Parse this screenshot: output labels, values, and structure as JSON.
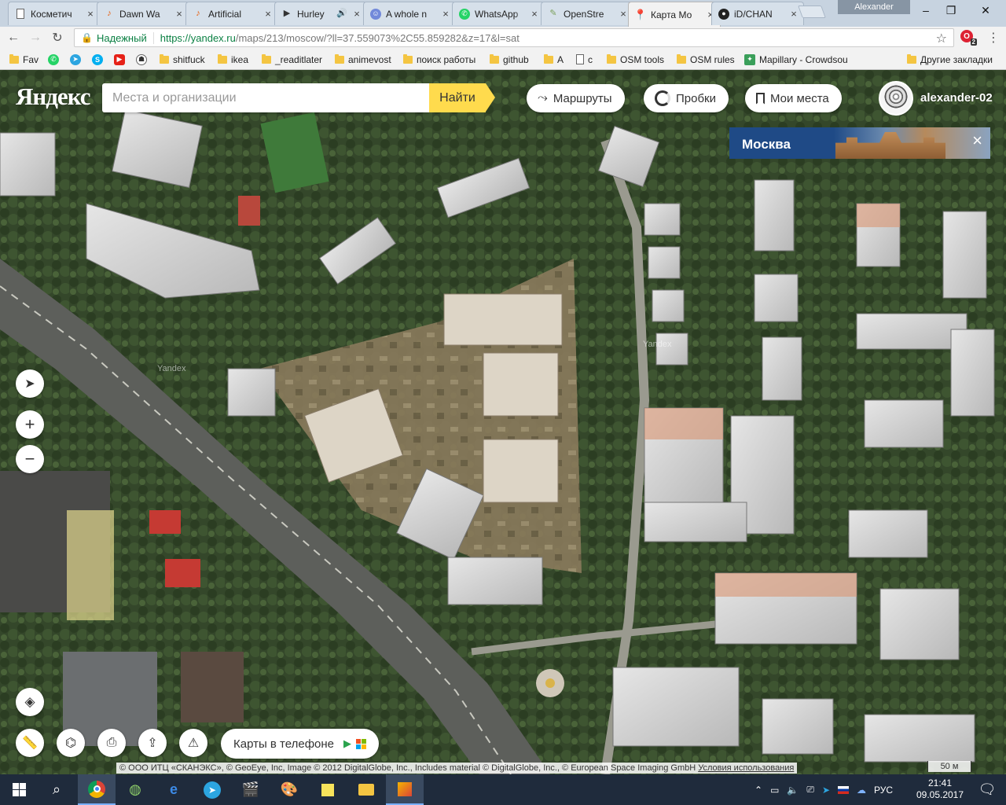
{
  "browser": {
    "tabs": [
      {
        "title": "Косметич",
        "icon": "page-icon",
        "close": "×"
      },
      {
        "title": "Dawn Wa",
        "icon": "music-note-icon",
        "close": "×"
      },
      {
        "title": "Artificial",
        "icon": "music-note-icon",
        "close": "×"
      },
      {
        "title": "Hurley",
        "icon": "play-icon",
        "close": "×"
      },
      {
        "title": "A whole n",
        "icon": "discord-icon",
        "close": "×"
      },
      {
        "title": "WhatsApp",
        "icon": "whatsapp-icon",
        "close": "×"
      },
      {
        "title": "OpenStre",
        "icon": "osm-icon",
        "close": "×"
      },
      {
        "title": "Карта Мо",
        "icon": "map-pin-icon",
        "close": "×",
        "active": true
      },
      {
        "title": "iD/CHAN",
        "icon": "github-icon",
        "close": "×"
      }
    ],
    "profile_name": "Alexander",
    "window_controls": {
      "minimize": "–",
      "maximize": "❐",
      "close": "✕"
    },
    "security_label": "Надежный",
    "url_domain": "https://yandex.ru",
    "url_path": "/maps/213/moscow/?ll=37.559073%2C55.859282&z=17&l=sat",
    "extension_badge": "2",
    "bookmarks": [
      {
        "label": "Fav",
        "icon": "folder"
      },
      {
        "label": "",
        "icon": "whatsapp-icon"
      },
      {
        "label": "",
        "icon": "telegram-icon"
      },
      {
        "label": "",
        "icon": "skype-icon"
      },
      {
        "label": "",
        "icon": "youtube-icon"
      },
      {
        "label": "",
        "icon": "robot-icon"
      },
      {
        "label": "shitfuck",
        "icon": "folder"
      },
      {
        "label": "ikea",
        "icon": "folder"
      },
      {
        "label": "_readitlater",
        "icon": "folder"
      },
      {
        "label": "animevost",
        "icon": "folder"
      },
      {
        "label": "поиск работы",
        "icon": "folder"
      },
      {
        "label": "github",
        "icon": "folder"
      },
      {
        "label": "A",
        "icon": "folder"
      },
      {
        "label": "c",
        "icon": "page"
      },
      {
        "label": "OSM tools",
        "icon": "folder"
      },
      {
        "label": "OSM rules",
        "icon": "folder"
      },
      {
        "label": "Mapillary - Crowdsou",
        "icon": "mapillary-icon"
      }
    ],
    "other_bookmarks": "Другие закладки"
  },
  "yandex": {
    "logo": "Яндекс",
    "search_placeholder": "Места и организации",
    "search_button": "Найти",
    "routes_label": "Маршруты",
    "traffic_label": "Пробки",
    "my_places_label": "Мои места",
    "username": "alexander-02",
    "city_card": {
      "name": "Москва",
      "close": "×"
    },
    "app_promo": "Карты в телефоне",
    "copyright_text": "© ООО ИТЦ «СКАНЭКС», © GeoEye, Inc, Image © 2012 DigitalGlobe, Inc., Includes material © DigitalGlobe, Inc., © European Space Imaging GmbH",
    "terms_link": "Условия использования",
    "scale_label": "50 м",
    "watermark": "Yandex",
    "controls": {
      "zoom_in": "+",
      "zoom_out": "−"
    }
  },
  "taskbar": {
    "language": "РУС",
    "time": "21:41",
    "date": "09.05.2017"
  },
  "colors": {
    "accent_yellow": "#ffdb4d",
    "secure_green": "#0b8043",
    "taskbar_bg": "#1f2b3c"
  }
}
